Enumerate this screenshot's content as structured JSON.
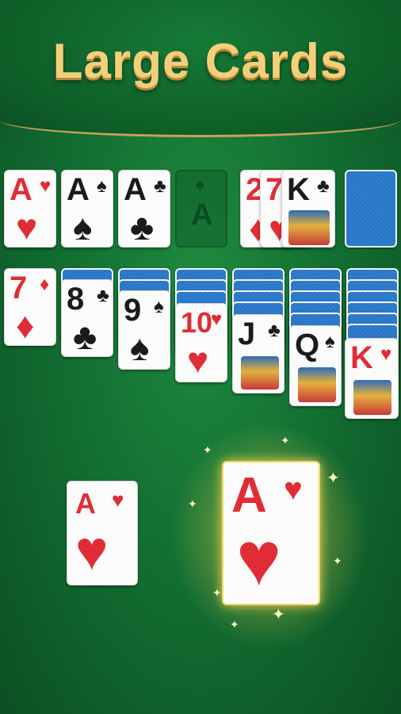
{
  "header": {
    "title": "Large Cards"
  },
  "foundations": [
    {
      "rank": "A",
      "suit": "♥",
      "color": "red"
    },
    {
      "rank": "A",
      "suit": "♠",
      "color": "black"
    },
    {
      "rank": "A",
      "suit": "♣",
      "color": "black"
    },
    {
      "rank": "A",
      "suit": "♠",
      "color": "slot"
    }
  ],
  "waste": [
    {
      "rank": "2",
      "suit": "♦",
      "color": "red"
    },
    {
      "rank": "7",
      "suit": "♥",
      "color": "red"
    },
    {
      "rank": "K",
      "suit": "♣",
      "color": "black"
    }
  ],
  "tableau": [
    {
      "rank": "7",
      "suit": "♦",
      "color": "red",
      "hidden": 0
    },
    {
      "rank": "8",
      "suit": "♣",
      "color": "black",
      "hidden": 1
    },
    {
      "rank": "9",
      "suit": "♠",
      "color": "black",
      "hidden": 2
    },
    {
      "rank": "10",
      "suit": "♥",
      "color": "red",
      "hidden": 3
    },
    {
      "rank": "J",
      "suit": "♣",
      "color": "black",
      "hidden": 4
    },
    {
      "rank": "Q",
      "suit": "♠",
      "color": "black",
      "hidden": 5
    },
    {
      "rank": "K",
      "suit": "♥",
      "color": "red",
      "hidden": 6
    }
  ],
  "comparison": {
    "small": {
      "rank": "A",
      "suit": "♥"
    },
    "large": {
      "rank": "A",
      "suit": "♥"
    }
  },
  "colors": {
    "felt": "#137033",
    "gold": "#f4cf7a",
    "red": "#e02d35",
    "back": "#2f7fd0"
  }
}
